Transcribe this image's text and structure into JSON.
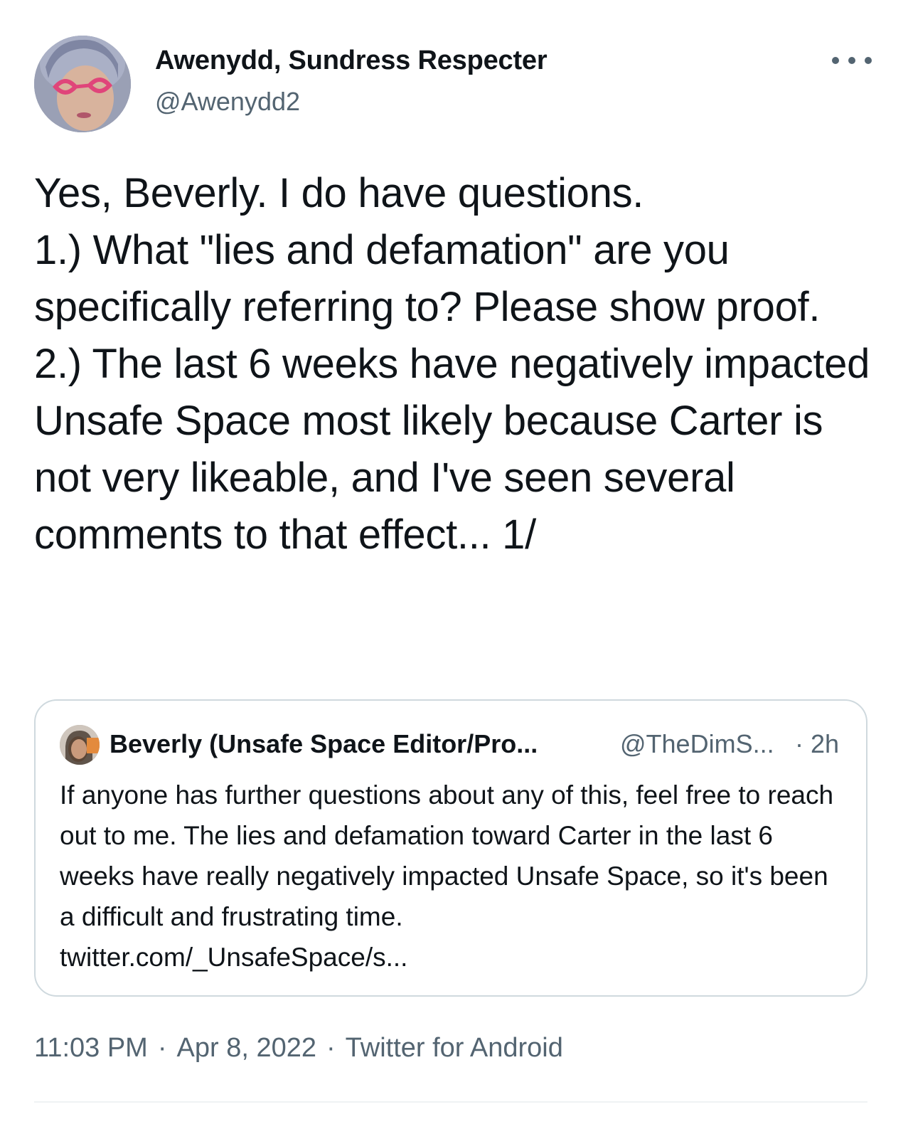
{
  "author": {
    "display_name": "Awenydd, Sundress Respecter",
    "handle": "@Awenydd2",
    "avatar_icon": "profile-photo-pink-heart-glasses"
  },
  "tweet": {
    "text": "Yes, Beverly. I do have questions.\n1.) What \"lies and defamation\" are you specifically referring to? Please show proof.\n2.) The last 6 weeks have negatively impacted Unsafe Space most likely because Carter is not very likeable, and I've seen several comments to that effect... 1/"
  },
  "quoted_tweet": {
    "display_name": "Beverly (Unsafe Space Editor/Pro...",
    "handle": "@TheDimS...",
    "separator": "·",
    "time": "2h",
    "text": "If anyone has further questions about any of this, feel free to reach out to me. The lies and defamation toward Carter in the last 6 weeks have really negatively impacted Unsafe Space, so it's been a difficult and frustrating time.\ntwitter.com/_UnsafeSpace/s..."
  },
  "footer": {
    "time": "11:03 PM",
    "separator": "·",
    "date": "Apr 8, 2022",
    "source": "Twitter for Android"
  },
  "colors": {
    "text_primary": "#0f1419",
    "text_secondary": "#536471",
    "border": "#cfd9de"
  }
}
